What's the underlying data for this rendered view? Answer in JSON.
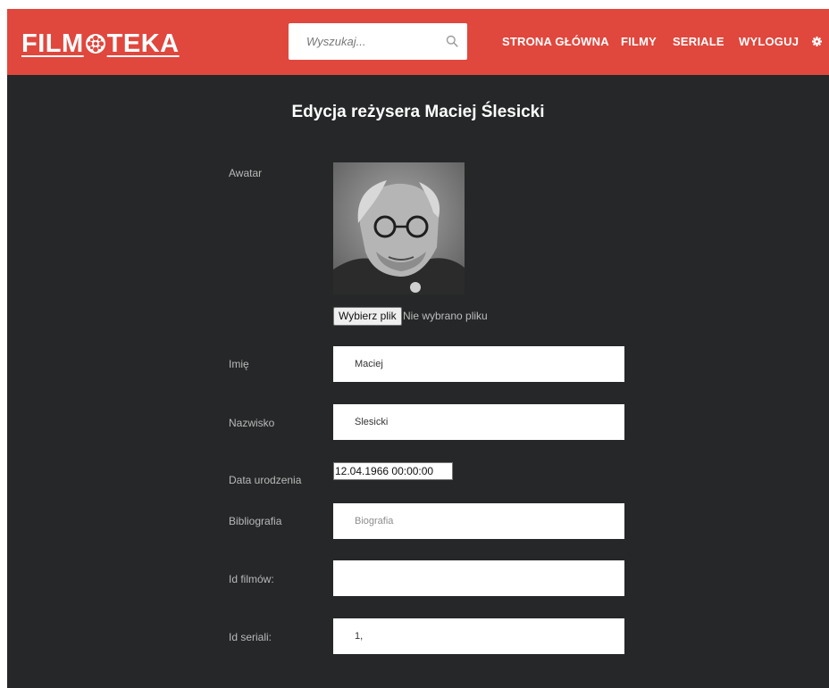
{
  "navbar": {
    "logo_text": "FILMOTEKA",
    "logo_left": "FILM",
    "logo_right": "TEKA",
    "search_placeholder": "Wyszukaj...",
    "links": [
      "STRONA GŁÓWNA",
      "FILMY",
      "SERIALE",
      "WYLOGUJ"
    ],
    "accent_color": "#e0473d",
    "icons": [
      "film-reel-icon",
      "search-icon",
      "gear-icon"
    ]
  },
  "page": {
    "title": "Edycja reżysera Maciej Ślesicki",
    "background": "#252728"
  },
  "form": {
    "avatar_label": "Awatar",
    "file_button": "Wybierz plik",
    "file_status": "Nie wybrano pliku",
    "first_name_label": "Imię",
    "first_name_value": "Maciej",
    "last_name_label": "Nazwisko",
    "last_name_value": "Ślesicki",
    "birth_date_label": "Data urodzenia",
    "birth_date_value": "12.04.1966 00:00:00",
    "bio_label": "Bibliografia",
    "bio_placeholder": "Biografia",
    "film_ids_label": "Id filmów:",
    "film_ids_value": "",
    "series_ids_label": "Id seriali:",
    "series_ids_value": "1,"
  }
}
